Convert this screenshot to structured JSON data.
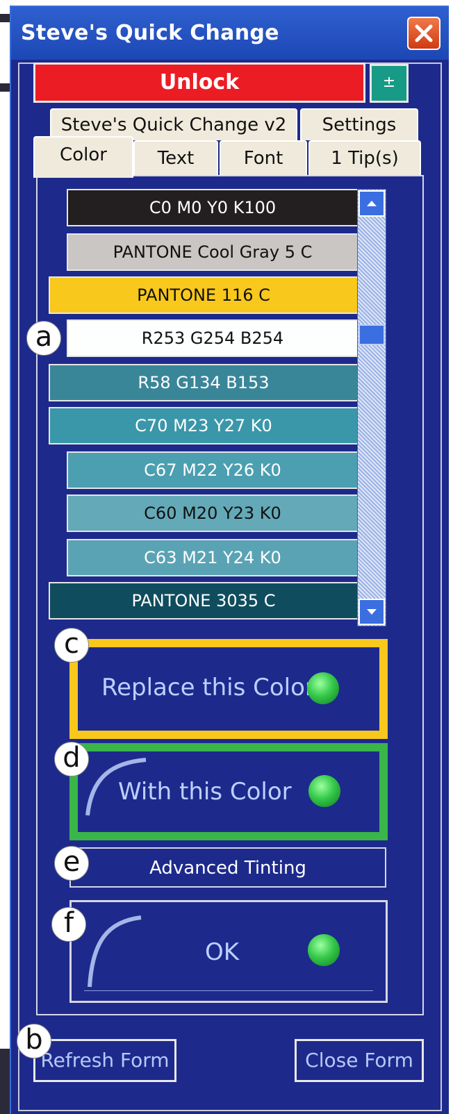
{
  "window": {
    "title": "Steve's Quick Change"
  },
  "top": {
    "unlock_label": "Unlock",
    "plusminus_label": "±"
  },
  "tabs": {
    "row1": [
      "Steve's Quick Change v2",
      "Settings"
    ],
    "row2": [
      "Color",
      "Text",
      "Font",
      "1 Tip(s)"
    ],
    "active": "Color"
  },
  "color_list": [
    {
      "label": "C0 M0 Y0 K100",
      "bg": "#231f20",
      "fg": "#ffffff"
    },
    {
      "label": "PANTONE Cool Gray 5 C",
      "bg": "#c9c6c4",
      "fg": "#111111"
    },
    {
      "label": "PANTONE 116 C",
      "bg": "#f8c81c",
      "fg": "#111111"
    },
    {
      "label": "R253 G254 B254",
      "bg": "#fdfefe",
      "fg": "#111111"
    },
    {
      "label": "R58 G134 B153",
      "bg": "#3a8699",
      "fg": "#ffffff"
    },
    {
      "label": "C70 M23 Y27 K0",
      "bg": "#3a97a9",
      "fg": "#ffffff"
    },
    {
      "label": "C67 M22 Y26 K0",
      "bg": "#4b9fb0",
      "fg": "#ffffff"
    },
    {
      "label": "C60 M20 Y23 K0",
      "bg": "#64a9b8",
      "fg": "#111111"
    },
    {
      "label": "C63 M21 Y24 K0",
      "bg": "#5aa3b4",
      "fg": "#ffffff"
    },
    {
      "label": "PANTONE 3035 C",
      "bg": "#0f4d5e",
      "fg": "#ffffff"
    }
  ],
  "buttons": {
    "replace": {
      "label": "Replace this Color",
      "border": "#f8c81c"
    },
    "with": {
      "label": "With this Color",
      "border": "#3ab54a"
    },
    "advanced": {
      "label": "Advanced Tinting"
    },
    "ok": {
      "label": "OK"
    },
    "refresh": {
      "label": "Refresh Form"
    },
    "close": {
      "label": "Close Form"
    }
  },
  "callouts": {
    "a": "a",
    "b": "b",
    "c": "c",
    "d": "d",
    "e": "e",
    "f": "f"
  },
  "colors": {
    "window_bg": "#1d2a8c",
    "titlebar": "#2f5fcf",
    "unlock_red": "#ec1c24"
  }
}
